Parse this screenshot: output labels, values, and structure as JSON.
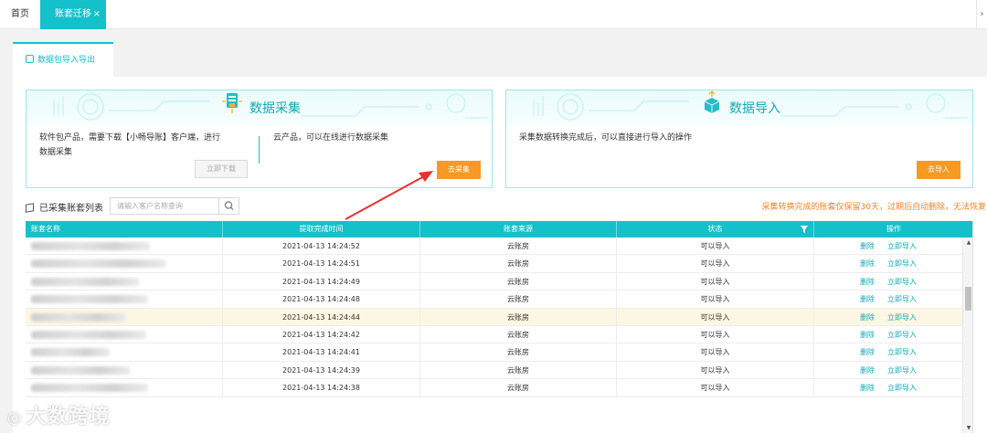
{
  "topbar": {
    "tabs": [
      {
        "label": "首页"
      },
      {
        "label": "账套迁移",
        "close": "×"
      }
    ],
    "edge_glyph": "›"
  },
  "subtab": {
    "label": "数据包导入导出"
  },
  "collect_card": {
    "title": "数据采集",
    "software_desc_line1": "软件包产品，需要下载【小畅导账】客户端，进行",
    "software_desc_line2": "数据采集",
    "cloud_desc": "云产品，可以在线进行数据采集",
    "download_button": "立即下载",
    "collect_button": "去采集"
  },
  "import_card": {
    "title": "数据导入",
    "desc": "采集数据转换完成后，可以直接进行导入的操作",
    "import_button": "去导入"
  },
  "list": {
    "title": "已采集账套列表",
    "search_placeholder": "请输入客户名称查询",
    "notice": "采集转换完成的账套仅保留30天，过期后自动删除，无法恢复"
  },
  "table": {
    "headers": [
      "账套名称",
      "提取完成时间",
      "账套来源",
      "状态",
      "操作"
    ],
    "rows": [
      {
        "name": "",
        "time": "2021-04-13 14:24:52",
        "source": "云账房",
        "status": "可以导入",
        "delete": "删除",
        "import": "立即导入"
      },
      {
        "name": "",
        "time": "2021-04-13 14:24:51",
        "source": "云账房",
        "status": "可以导入",
        "delete": "删除",
        "import": "立即导入"
      },
      {
        "name": "",
        "time": "2021-04-13 14:24:49",
        "source": "云账房",
        "status": "可以导入",
        "delete": "删除",
        "import": "立即导入"
      },
      {
        "name": "",
        "time": "2021-04-13 14:24:48",
        "source": "云账房",
        "status": "可以导入",
        "delete": "删除",
        "import": "立即导入"
      },
      {
        "name": "",
        "time": "2021-04-13 14:24:44",
        "source": "云账房",
        "status": "可以导入",
        "delete": "删除",
        "import": "立即导入",
        "highlighted": true
      },
      {
        "name": "",
        "time": "2021-04-13 14:24:42",
        "source": "云账房",
        "status": "可以导入",
        "delete": "删除",
        "import": "立即导入"
      },
      {
        "name": "",
        "time": "2021-04-13 14:24:41",
        "source": "云账房",
        "status": "可以导入",
        "delete": "删除",
        "import": "立即导入"
      },
      {
        "name": "",
        "time": "2021-04-13 14:24:39",
        "source": "云账房",
        "status": "可以导入",
        "delete": "删除",
        "import": "立即导入"
      },
      {
        "name": "",
        "time": "2021-04-13 14:24:38",
        "source": "云账房",
        "status": "可以导入",
        "delete": "删除",
        "import": "立即导入"
      }
    ]
  },
  "watermark": "大数跨境",
  "colors": {
    "accent": "#14c0c9",
    "orange": "#f79a22",
    "notice": "#f0852c",
    "highlight_row": "#fdf6e2",
    "annotation_arrow": "#e8312c"
  },
  "icons": [
    "close-icon",
    "form-icon",
    "server-lock-icon",
    "box-upload-icon",
    "cube-icon",
    "search-icon",
    "filter-icon",
    "arrow-annotation"
  ]
}
